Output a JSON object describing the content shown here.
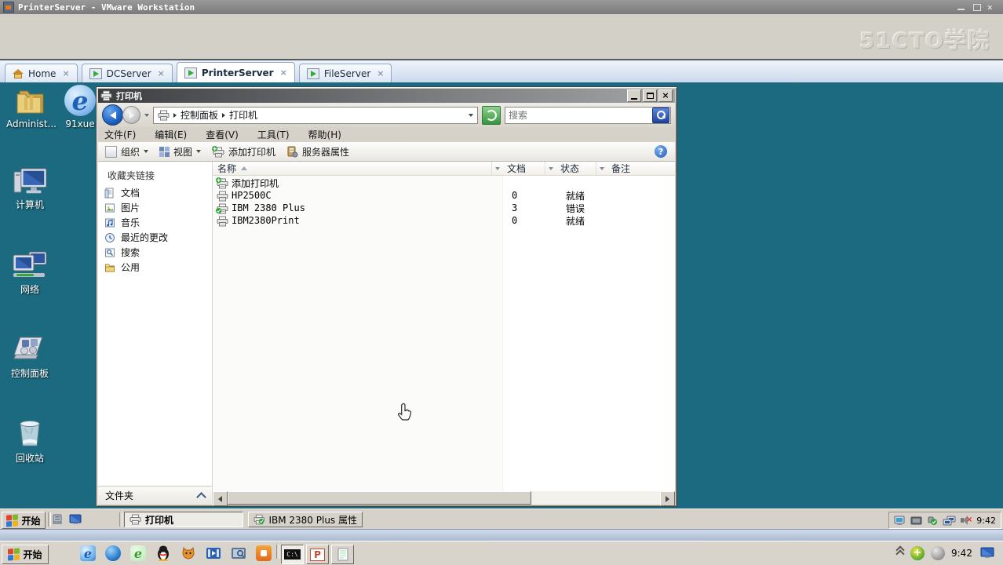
{
  "icons": {
    "close": "×",
    "help": "?",
    "ie_letter": "e",
    "green_e_letter": "e",
    "ppt_letter": "P",
    "cmd_label": "C:\\"
  },
  "vmware": {
    "title": "PrinterServer - VMware Workstation",
    "watermark": "51CTO学院",
    "tabs": [
      {
        "label": "Home"
      },
      {
        "label": "DCServer"
      },
      {
        "label": "PrinterServer"
      },
      {
        "label": "FileServer"
      }
    ]
  },
  "desktop_icons": [
    {
      "label": "Administ..."
    },
    {
      "label": "91xue"
    },
    {
      "label": "计算机"
    },
    {
      "label": "网络"
    },
    {
      "label": "控制面板"
    },
    {
      "label": "回收站"
    }
  ],
  "printer_window": {
    "title": "打印机",
    "breadcrumb": {
      "root": "控制面板",
      "current": "打印机"
    },
    "search_placeholder": "搜索",
    "menu": {
      "file": "文件(F)",
      "edit": "编辑(E)",
      "view": "查看(V)",
      "tools": "工具(T)",
      "help": "帮助(H)"
    },
    "toolbar": {
      "organize": "组织",
      "views": "视图",
      "add_printer": "添加打印机",
      "server_properties": "服务器属性"
    },
    "nav": {
      "header": "收藏夹链接",
      "items": [
        {
          "label": "文档"
        },
        {
          "label": "图片"
        },
        {
          "label": "音乐"
        },
        {
          "label": "最近的更改"
        },
        {
          "label": "搜索"
        },
        {
          "label": "公用"
        }
      ],
      "footer": "文件夹"
    },
    "list": {
      "columns": [
        {
          "label": "名称"
        },
        {
          "label": "文档"
        },
        {
          "label": "状态"
        },
        {
          "label": "备注"
        }
      ],
      "rows": [
        {
          "name": "添加打印机",
          "docs": "",
          "status": "",
          "comment": ""
        },
        {
          "name": "HP2500C",
          "docs": "0",
          "status": "就绪",
          "comment": ""
        },
        {
          "name": "IBM 2380 Plus",
          "docs": "3",
          "status": "错误",
          "comment": ""
        },
        {
          "name": "IBM2380Print",
          "docs": "0",
          "status": "就绪",
          "comment": ""
        }
      ]
    }
  },
  "guest_taskbar": {
    "start_label": "开始",
    "window_buttons": [
      {
        "label": "打印机"
      },
      {
        "label": "IBM 2380 Plus 属性"
      }
    ],
    "clock": "9:42"
  },
  "host_taskbar": {
    "start_label": "开始",
    "clock": "9:42"
  }
}
